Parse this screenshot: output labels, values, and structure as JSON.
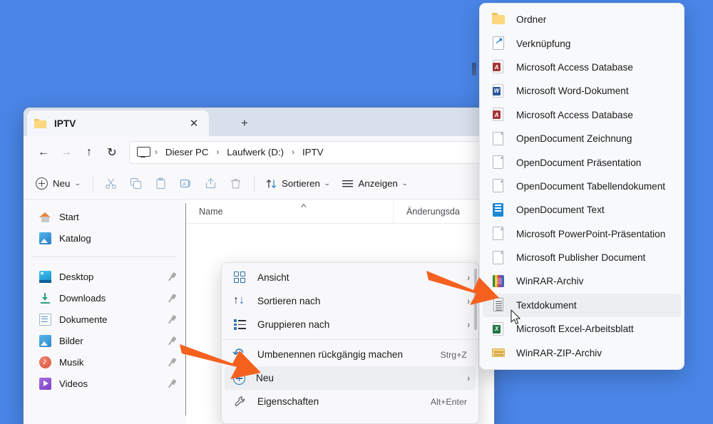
{
  "desktop": {
    "background_color": "#4a86e8"
  },
  "window": {
    "tab": {
      "title": "IPTV",
      "folder_icon": "folder-icon",
      "close_icon": "close-icon"
    },
    "new_tab_label": "+",
    "nav": {
      "back_icon": "arrow-left-icon",
      "forward_icon": "arrow-right-icon",
      "up_icon": "arrow-up-icon",
      "refresh_icon": "refresh-icon"
    },
    "breadcrumb": {
      "pc_icon": "this-pc-icon",
      "items": [
        "Dieser PC",
        "Laufwerk (D:)",
        "IPTV"
      ],
      "separator": "›"
    },
    "toolbar": {
      "new_label": "Neu",
      "new_icon": "plus-circle-icon",
      "chevron": "˅",
      "cut_icon": "scissors-icon",
      "copy_icon": "copy-icon",
      "paste_icon": "paste-icon",
      "rename_icon": "rename-icon",
      "share_icon": "share-icon",
      "delete_icon": "trash-icon",
      "sort_label": "Sortieren",
      "sort_icon": "sort-icon",
      "view_label": "Anzeigen",
      "view_icon": "list-icon"
    },
    "sidebar": {
      "top_items": [
        {
          "label": "Start",
          "icon": "home-icon",
          "pinned": false
        },
        {
          "label": "Katalog",
          "icon": "gallery-icon",
          "pinned": false
        }
      ],
      "quick_access": [
        {
          "label": "Desktop",
          "icon": "desktop-icon",
          "pinned": true
        },
        {
          "label": "Downloads",
          "icon": "download-icon",
          "pinned": true
        },
        {
          "label": "Dokumente",
          "icon": "documents-icon",
          "pinned": true
        },
        {
          "label": "Bilder",
          "icon": "pictures-icon",
          "pinned": true
        },
        {
          "label": "Musik",
          "icon": "music-icon",
          "pinned": true
        },
        {
          "label": "Videos",
          "icon": "videos-icon",
          "pinned": true
        }
      ]
    },
    "columns": [
      {
        "label": "Name",
        "sorted": true,
        "sort_caret": "˄"
      },
      {
        "label": "Änderungsda"
      }
    ]
  },
  "context_menu": {
    "items": [
      {
        "label": "Ansicht",
        "icon": "view-grid-icon",
        "accel": "",
        "submenu": true,
        "highlighted": false
      },
      {
        "label": "Sortieren nach",
        "icon": "sort-icon",
        "accel": "",
        "submenu": true,
        "highlighted": false
      },
      {
        "label": "Gruppieren nach",
        "icon": "group-icon",
        "accel": "",
        "submenu": true,
        "highlighted": false
      },
      {
        "label": "Umbenennen rückgängig machen",
        "icon": "undo-icon",
        "accel": "Strg+Z",
        "submenu": false,
        "highlighted": false
      },
      {
        "label": "Neu",
        "icon": "plus-circle-icon",
        "accel": "",
        "submenu": true,
        "highlighted": true
      },
      {
        "label": "Eigenschaften",
        "icon": "wrench-icon",
        "accel": "Alt+Enter",
        "submenu": false,
        "highlighted": false
      }
    ],
    "divider_after_index": 2,
    "arrow_glyph": "›"
  },
  "new_submenu": {
    "items": [
      {
        "label": "Ordner",
        "icon": "folder-icon",
        "highlighted": false
      },
      {
        "label": "Verknüpfung",
        "icon": "shortcut-icon",
        "highlighted": false
      },
      {
        "label": "Microsoft Access Database",
        "icon": "access-icon",
        "highlighted": false
      },
      {
        "label": "Microsoft Word-Dokument",
        "icon": "word-icon",
        "highlighted": false
      },
      {
        "label": "Microsoft Access Database",
        "icon": "access-icon",
        "highlighted": false
      },
      {
        "label": "OpenDocument Zeichnung",
        "icon": "blank-page-icon",
        "highlighted": false
      },
      {
        "label": "OpenDocument Präsentation",
        "icon": "blank-page-icon",
        "highlighted": false
      },
      {
        "label": "OpenDocument Tabellendokument",
        "icon": "blank-page-icon",
        "highlighted": false
      },
      {
        "label": "OpenDocument Text",
        "icon": "opendocument-text-icon",
        "highlighted": false
      },
      {
        "label": "Microsoft PowerPoint-Präsentation",
        "icon": "blank-page-icon",
        "highlighted": false
      },
      {
        "label": "Microsoft Publisher Document",
        "icon": "blank-page-icon",
        "highlighted": false
      },
      {
        "label": "WinRAR-Archiv",
        "icon": "winrar-icon",
        "highlighted": false
      },
      {
        "label": "Textdokument",
        "icon": "text-document-icon",
        "highlighted": true
      },
      {
        "label": "Microsoft Excel-Arbeitsblatt",
        "icon": "excel-icon",
        "highlighted": false
      },
      {
        "label": "WinRAR-ZIP-Archiv",
        "icon": "winrar-zip-icon",
        "highlighted": false
      }
    ]
  },
  "annotations": {
    "color": "#f4611e",
    "arrows": [
      {
        "name": "arrow-pointing-to-neu",
        "target": "Neu"
      },
      {
        "name": "arrow-pointing-to-textdokument",
        "target": "Textdokument"
      }
    ]
  },
  "cursor": {
    "type": "default-pointer"
  }
}
